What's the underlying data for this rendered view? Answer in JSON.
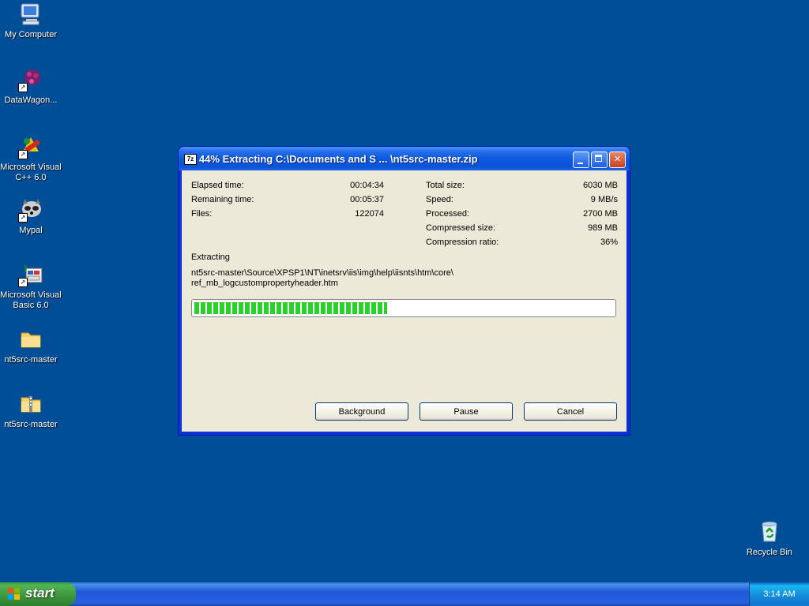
{
  "desktop": {
    "icons": [
      {
        "label": "My Computer",
        "icon": "my-computer-icon"
      },
      {
        "label": "DataWagon...",
        "icon": "datawagon-icon"
      },
      {
        "label": "Microsoft Visual C++ 6.0",
        "icon": "visual-cpp-icon"
      },
      {
        "label": "Mypal",
        "icon": "mypal-icon"
      },
      {
        "label": "Microsoft Visual Basic 6.0",
        "icon": "visual-basic-icon"
      },
      {
        "label": "nt5src-master",
        "icon": "folder-icon"
      },
      {
        "label": "nt5src-master",
        "icon": "zip-folder-icon"
      },
      {
        "label": "Recycle Bin",
        "icon": "recycle-bin-icon"
      }
    ],
    "background_color": "#004e98"
  },
  "dialog": {
    "app_icon_text": "7z",
    "title": "44% Extracting C:\\Documents and S ... \\nt5src-master.zip",
    "stats_left": [
      {
        "label": "Elapsed time:",
        "value": "00:04:34"
      },
      {
        "label": "Remaining time:",
        "value": "00:05:37"
      },
      {
        "label": "Files:",
        "value": "122074"
      }
    ],
    "stats_right": [
      {
        "label": "Total size:",
        "value": "6030 MB"
      },
      {
        "label": "Speed:",
        "value": "9 MB/s"
      },
      {
        "label": "Processed:",
        "value": "2700 MB"
      },
      {
        "label": "Compressed size:",
        "value": "989 MB"
      },
      {
        "label": "Compression ratio:",
        "value": "36%"
      }
    ],
    "operation_label": "Extracting",
    "current_path_line1": "nt5src-master\\Source\\XPSP1\\NT\\inetsrv\\iis\\img\\help\\iisnts\\htm\\core\\",
    "current_path_line2": "ref_mb_logcustompropertyheader.htm",
    "progress_fraction": 0.46,
    "progress_color": "#2bd12b",
    "buttons": {
      "background": "Background",
      "pause": "Pause",
      "cancel": "Cancel"
    }
  },
  "taskbar": {
    "start_label": "start",
    "clock": "3:14 AM"
  }
}
